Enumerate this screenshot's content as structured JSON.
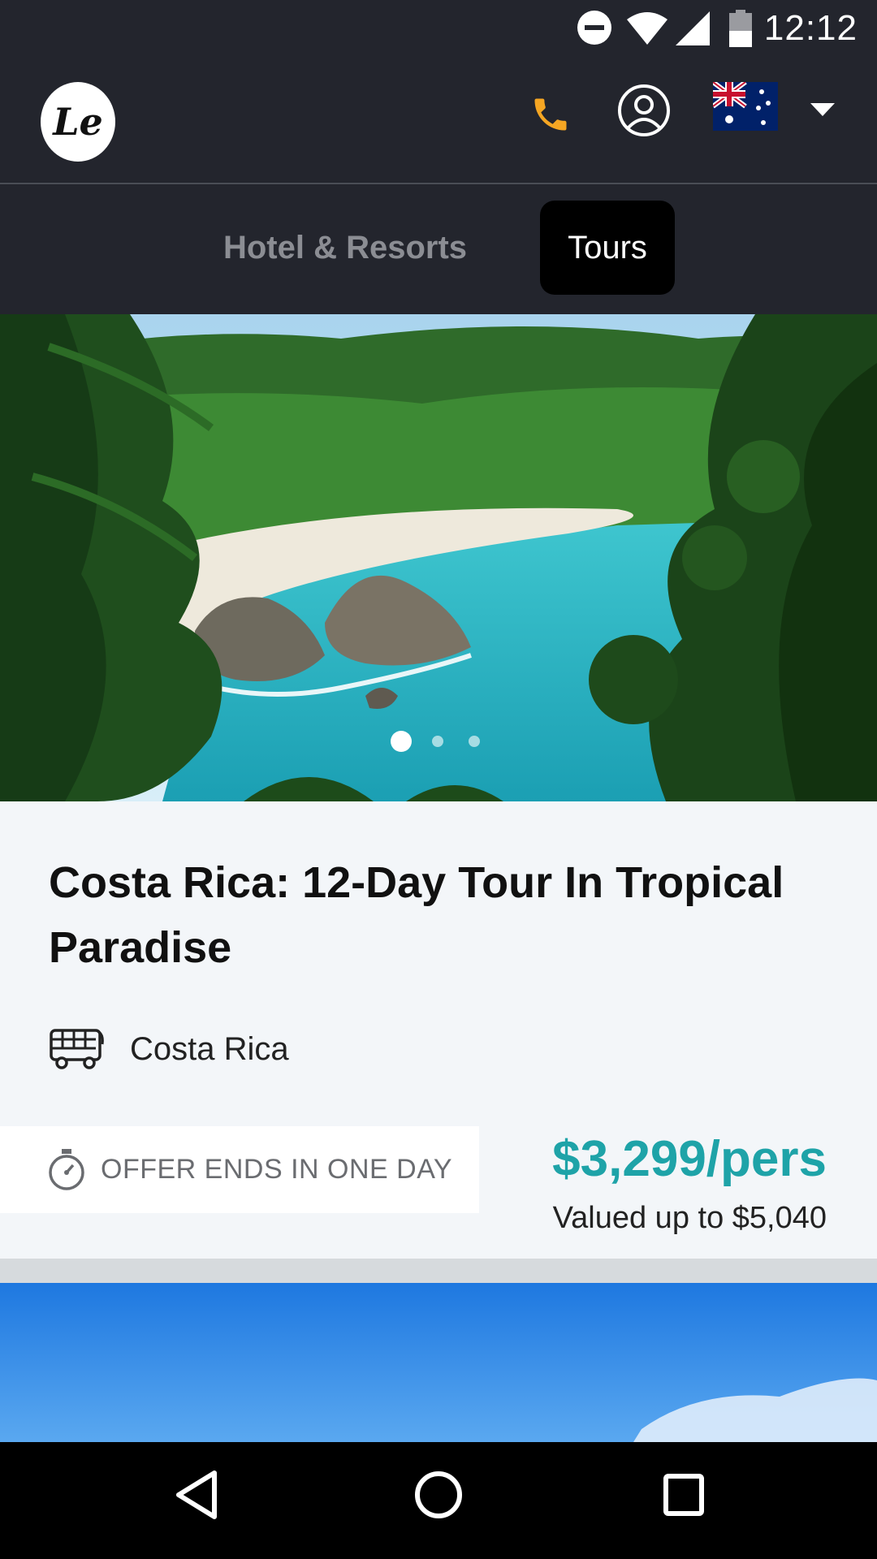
{
  "status_bar": {
    "time": "12:12",
    "icons": [
      "do-not-disturb-icon",
      "wifi-icon",
      "signal-icon",
      "battery-icon"
    ]
  },
  "header": {
    "logo_text": "Le",
    "icons": [
      "phone-icon",
      "user-account-icon",
      "australia-flag-icon",
      "dropdown-arrow-icon"
    ],
    "accent_color": "#f5a623"
  },
  "tabs": [
    {
      "label": "Hotel & Resorts",
      "active": false
    },
    {
      "label": "Tours",
      "active": true
    }
  ],
  "carousel": {
    "active_index": 0,
    "count": 3
  },
  "card": {
    "title": "Costa Rica: 12-Day Tour In Tropical Paradise",
    "location": "Costa Rica",
    "location_icon": "bus-icon",
    "offer_icon": "stopwatch-icon",
    "offer_text": "OFFER ENDS IN ONE DAY",
    "price": "$3,299/pers",
    "valued": "Valued up to $5,040",
    "price_color": "#1ea3a8"
  },
  "nav_bar": {
    "buttons": [
      "back-icon",
      "home-icon",
      "recents-icon"
    ]
  }
}
